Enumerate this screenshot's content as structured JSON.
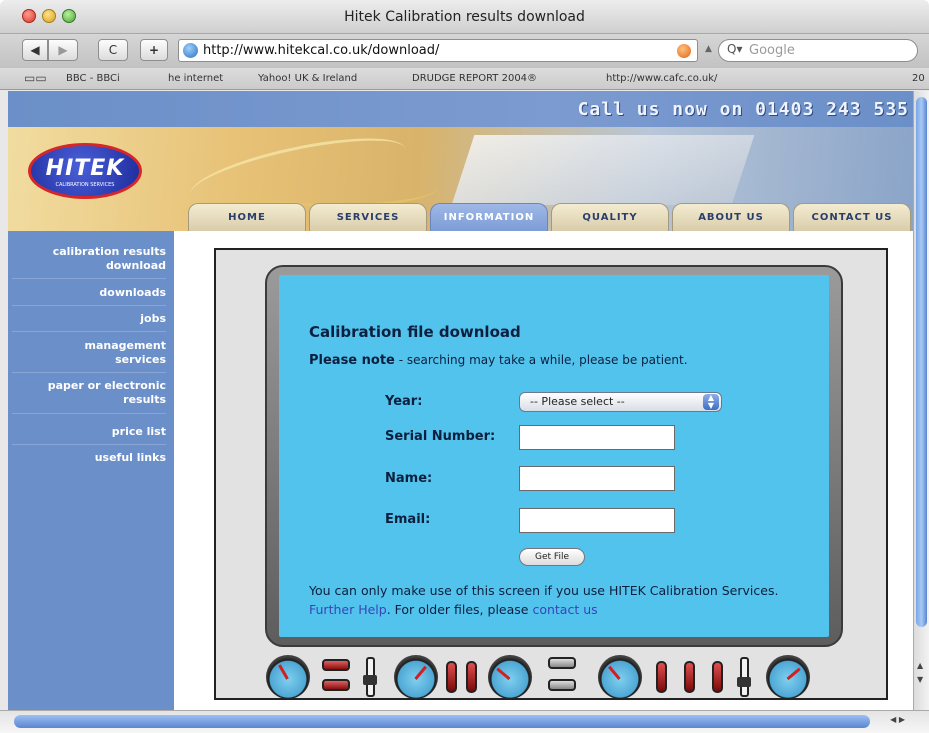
{
  "window": {
    "title": "Hitek Calibration results download"
  },
  "toolbar": {
    "back_label": "◀",
    "forward_label": "▶",
    "reload_label": "C",
    "add_label": "+",
    "url": "http://www.hitekcal.co.uk/download/",
    "search_placeholder": "Google"
  },
  "bookmarks": {
    "items": [
      "BBC - BBCi",
      "he internet",
      "Yahoo! UK & Ireland",
      "DRUDGE REPORT 2004®",
      "http://www.cafc.co.uk/",
      "20"
    ]
  },
  "header": {
    "call_us": "Call us now on 01403 243 535",
    "logo_text": "HITEK",
    "logo_sub": "CALIBRATION SERVICES",
    "tabs": [
      {
        "label": "HOME"
      },
      {
        "label": "SERVICES"
      },
      {
        "label": "INFORMATION"
      },
      {
        "label": "QUALITY"
      },
      {
        "label": "ABOUT US"
      },
      {
        "label": "CONTACT US"
      }
    ]
  },
  "sidebar": {
    "items": [
      {
        "label": "calibration results download"
      },
      {
        "label": "downloads"
      },
      {
        "label": "jobs"
      },
      {
        "label": "management services"
      },
      {
        "label": "paper or electronic results"
      },
      {
        "label": "price list"
      },
      {
        "label": "useful links"
      }
    ]
  },
  "form": {
    "title": "Calibration file download",
    "note_bold": "Please note",
    "note_rest": " - searching may take a while, please be patient.",
    "year_label": "Year:",
    "year_value": "-- Please select --",
    "serial_label": "Serial Number:",
    "name_label": "Name:",
    "email_label": "Email:",
    "submit_label": "Get File",
    "footer_1": "You can only make use of this screen if you use HITEK Calibration Services. ",
    "further_help": "Further Help",
    "footer_2": ". For older files, please ",
    "contact_us": "contact us"
  },
  "colors": {
    "site_blue": "#6b8fc8",
    "panel_blue": "#52c3ec",
    "link": "#3a44b8"
  }
}
